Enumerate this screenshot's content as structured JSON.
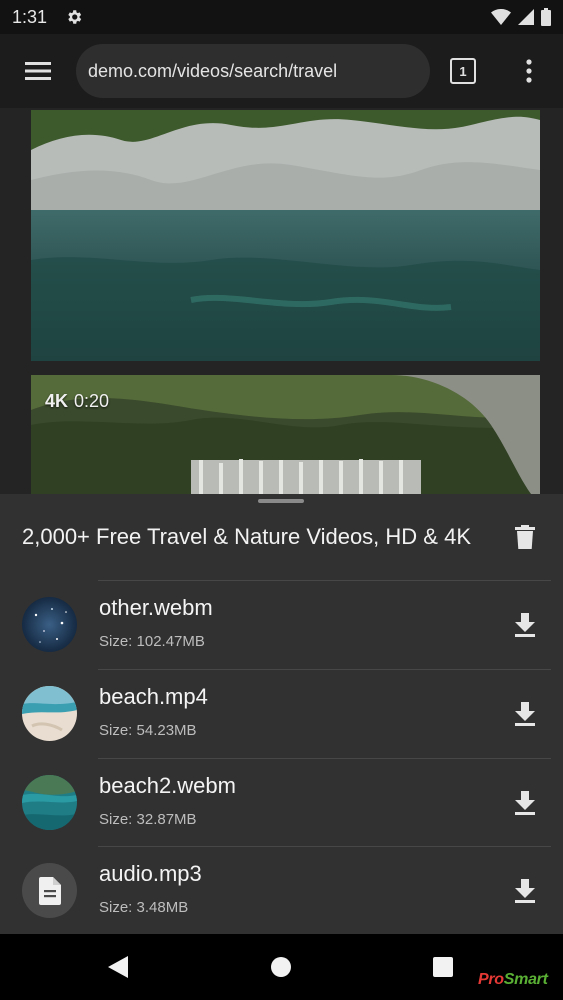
{
  "status_bar": {
    "time": "1:31",
    "icons": [
      "gear-icon",
      "wifi-icon",
      "signal-icon",
      "battery-icon"
    ]
  },
  "toolbar": {
    "url": "demo.com/videos/search/travel",
    "tab_count": "1",
    "icons": [
      "hamburger-menu-icon",
      "tab-switcher-icon",
      "more-vertical-icon"
    ]
  },
  "content": {
    "videos": [
      {
        "badge_quality": "",
        "badge_duration": ""
      },
      {
        "badge_quality": "4K",
        "badge_duration": "0:20"
      }
    ]
  },
  "sheet": {
    "title": "2,000+ Free Travel & Nature Videos, HD & 4K",
    "files": [
      {
        "name": "other.webm",
        "size": "Size: 102.47MB",
        "thumb": "starry-sky"
      },
      {
        "name": "beach.mp4",
        "size": "Size: 54.23MB",
        "thumb": "beach"
      },
      {
        "name": "beach2.webm",
        "size": "Size: 32.87MB",
        "thumb": "island"
      },
      {
        "name": "audio.mp3",
        "size": "Size: 3.48MB",
        "thumb": "document-icon"
      }
    ]
  },
  "navbar": {
    "icons": [
      "back-icon",
      "home-icon",
      "recents-icon"
    ]
  },
  "watermark": {
    "part1": "Pro",
    "part2": "Smart"
  },
  "colors": {
    "status_bar_bg": "#121212",
    "toolbar_bg": "#1c1c1c",
    "sheet_bg": "#313131",
    "watermark_green": "#5ab034",
    "watermark_red": "#e53935"
  }
}
